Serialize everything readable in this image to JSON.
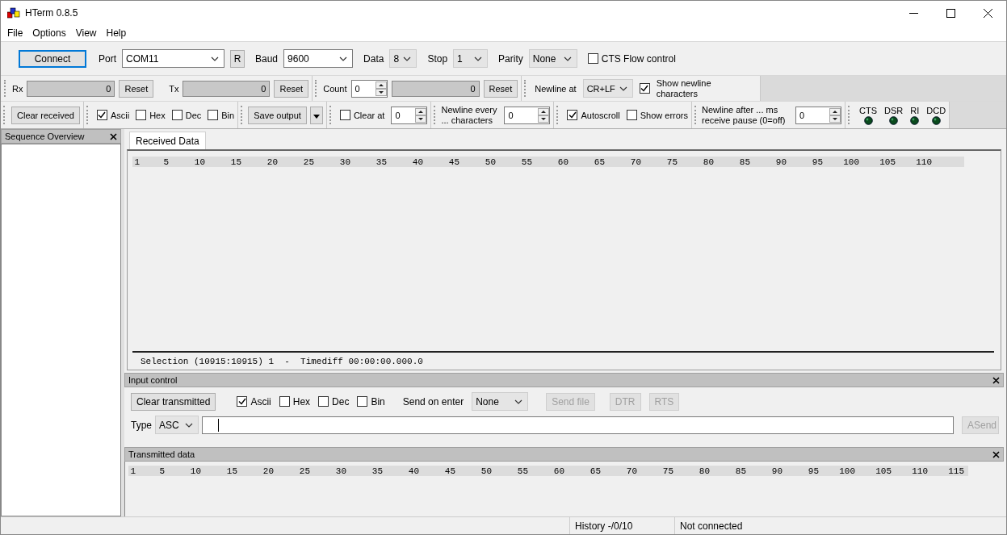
{
  "window": {
    "title": "HTerm 0.8.5"
  },
  "menu": [
    "File",
    "Options",
    "View",
    "Help"
  ],
  "connection": {
    "connect_button": {
      "label": "Connect",
      "focused": true
    },
    "port": {
      "label": "Port",
      "value": "COM11"
    },
    "rescan_button": "R",
    "baud": {
      "label": "Baud",
      "value": "9600"
    },
    "data": {
      "label": "Data",
      "value": "8"
    },
    "stop": {
      "label": "Stop",
      "value": "1"
    },
    "parity": {
      "label": "Parity",
      "value": "None"
    },
    "cts_flow_control": {
      "label": "CTS Flow control",
      "checked": false
    }
  },
  "counters": {
    "rx": {
      "label": "Rx",
      "value": "0",
      "reset": "Reset"
    },
    "tx": {
      "label": "Tx",
      "value": "0",
      "reset": "Reset"
    },
    "count": {
      "label": "Count",
      "value": "0",
      "total": "0",
      "reset": "Reset"
    },
    "newline_at": {
      "label": "Newline at",
      "value": "CR+LF"
    },
    "show_newline": {
      "label": "Show newline characters",
      "checked": true
    }
  },
  "receive_options": {
    "clear_button": "Clear received",
    "formats": [
      {
        "label": "Ascii",
        "checked": true
      },
      {
        "label": "Hex",
        "checked": false
      },
      {
        "label": "Dec",
        "checked": false
      },
      {
        "label": "Bin",
        "checked": false
      }
    ],
    "save_output": "Save output",
    "clear_at": {
      "label": "Clear at",
      "checked": false,
      "value": "0"
    },
    "newline_every": {
      "label": "Newline every ... characters",
      "value": "0"
    },
    "autoscroll": {
      "label": "Autoscroll",
      "checked": true
    },
    "show_errors": {
      "label": "Show errors",
      "checked": false
    },
    "newline_after": {
      "label": "Newline after ... ms receive pause (0=off)",
      "value": "0"
    },
    "lines": [
      {
        "label": "CTS",
        "on": false
      },
      {
        "label": "DSR",
        "on": false
      },
      {
        "label": "RI",
        "on": false
      },
      {
        "label": "DCD",
        "on": false
      }
    ]
  },
  "sequence_overview": {
    "title": "Sequence Overview"
  },
  "received": {
    "tabs": [
      {
        "label": "Received Data",
        "selected": true
      }
    ],
    "ruler": [
      "1",
      "5",
      "10",
      "15",
      "20",
      "25",
      "30",
      "35",
      "40",
      "45",
      "50",
      "55",
      "60",
      "65",
      "70",
      "75",
      "80",
      "85",
      "90",
      "95",
      "100",
      "105",
      "110"
    ],
    "status": "Selection (10915:10915) 1  -  Timediff 00:00:00.000.0"
  },
  "input_control": {
    "title": "Input control",
    "clear_button": "Clear transmitted",
    "formats": [
      {
        "label": "Ascii",
        "checked": true
      },
      {
        "label": "Hex",
        "checked": false
      },
      {
        "label": "Dec",
        "checked": false
      },
      {
        "label": "Bin",
        "checked": false
      }
    ],
    "send_on_enter": {
      "label": "Send on enter",
      "value": "None"
    },
    "send_file": {
      "label": "Send file",
      "disabled": true
    },
    "dtr": {
      "label": "DTR",
      "disabled": true
    },
    "rts": {
      "label": "RTS",
      "disabled": true
    },
    "type": {
      "label": "Type",
      "value": "ASC"
    },
    "send_button": {
      "label": "ASend",
      "disabled": true
    }
  },
  "transmitted": {
    "title": "Transmitted data",
    "ruler": [
      "1",
      "5",
      "10",
      "15",
      "20",
      "25",
      "30",
      "35",
      "40",
      "45",
      "50",
      "55",
      "60",
      "65",
      "70",
      "75",
      "80",
      "85",
      "90",
      "95",
      "100",
      "105",
      "110",
      "115"
    ]
  },
  "status_bar": {
    "history": "History -/0/10",
    "connection": "Not connected"
  }
}
